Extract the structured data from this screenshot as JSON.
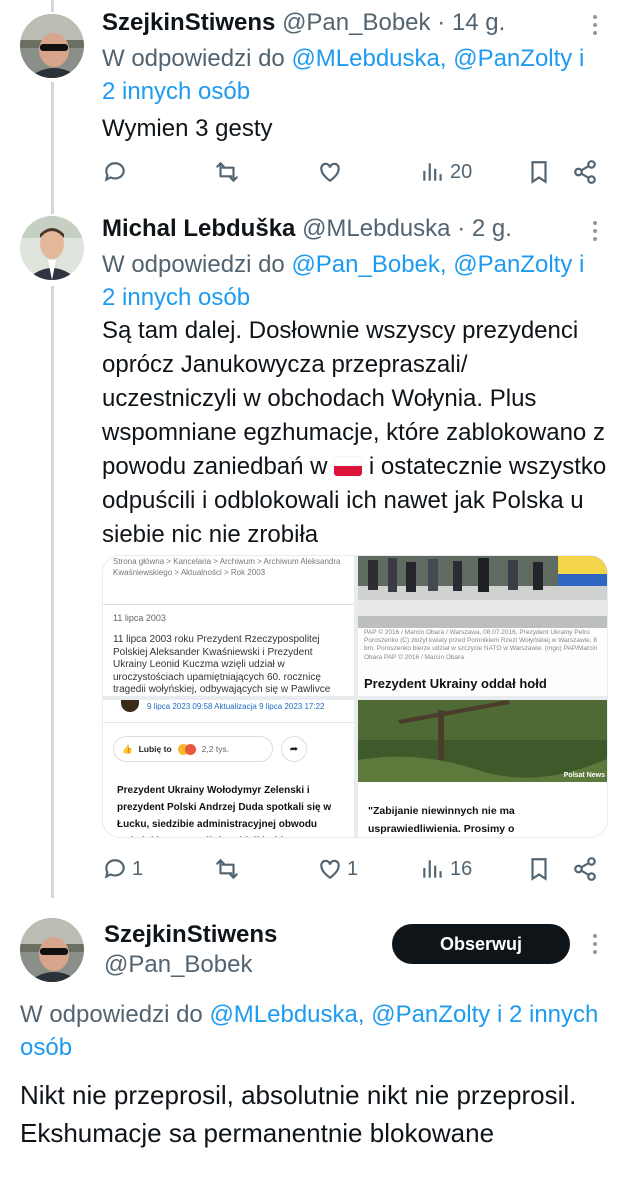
{
  "tweets": [
    {
      "name": "SzejkinStiwens",
      "handle": "@Pan_Bobek",
      "dot": "·",
      "time": "14 g.",
      "reply_prefix": "W odpowiedzi do",
      "reply_mentions": "@MLebduska, @PanZolty",
      "reply_suffix_mention": "i",
      "reply_others": "2 innych osób",
      "text": "Wymien 3 gesty",
      "actions": {
        "replies": "",
        "reposts": "",
        "likes": "",
        "views": "20"
      }
    },
    {
      "name": "Michal Lebduška",
      "handle": "@MLebduska",
      "dot": "·",
      "time": "2 g.",
      "reply_prefix": "W odpowiedzi do",
      "reply_mentions": "@Pan_Bobek, @PanZolty",
      "reply_suffix_mention": "i",
      "reply_others": "2 innych osób",
      "text_parts": [
        "Są tam dalej. Dosłownie wszyscy prezydenci oprócz Janukowycza przepraszali/ uczestniczyli w obchodach Wołynia. Plus wspomniane egzhumacje, które zablokowano z powodu zaniedbań w ",
        " i ostatecznie wszystko odpuścili i odblokowali ich nawet jak Polska u siebie nic nie zrobiła"
      ],
      "flag_emoji": "poland-flag-icon",
      "actions": {
        "replies": "1",
        "reposts": "",
        "likes": "1",
        "views": "16"
      },
      "media": {
        "img1": {
          "breadcrumb": "Strona główna > Kancelaria > Archiwum > Archiwum Aleksandra Kwaśniewskiego > Aktualności > Rok 2003",
          "date": "11 lipca 2003",
          "body": "11 lipca 2003 roku Prezydent Rzeczypospolitej Polskiej Aleksander Kwaśniewski i Prezydent Ukrainy Leonid Kuczma wzięli udział w uroczystościach upamiętniających 60. rocznicę tragedii wołyńskiej, odbywających się w Pawlivce"
        },
        "img2": {
          "caption": "PAP © 2016 / Marcin Obara / Warszawa, 08.07.2016, Prezydent Ukrainy Petro Poroszenko (C) złożył kwiaty przed Pomnikiem Rzezi Wołyńskiej w Warszawie, 8 bm. Poroszenko bierze udział w szczycie NATO w Warszawie. (mgo) PAP/Marcin Obara PAP © 2016 / Marcin Obara",
          "headline": "Prezydent Ukrainy oddał hołd"
        },
        "img3": {
          "meta": "9 lipca 2023 09:58 Aktualizacja 9 lipca 2023 17:22",
          "like_label": "Lubię to",
          "like_count": "2,2 tys.",
          "body": "Prezydent Ukrainy Wołodymyr Zelenski i prezydent Polski Andrzej Duda spotkali się w Łucku, siedzibie administracyjnej obwodu wołyńskiego. Wspólnie oddali hołd"
        },
        "img4": {
          "source": "Polsat News",
          "body": "\"Zabijanie niewinnych nie ma usprawiedliwienia. Prosimy o"
        }
      }
    },
    {
      "name": "SzejkinStiwens",
      "handle": "@Pan_Bobek",
      "follow_label": "Obserwuj",
      "reply_prefix": "W odpowiedzi do",
      "reply_mentions": "@MLebduska, @PanZolty",
      "reply_suffix_mention": "i",
      "reply_others_inline": "2 innych",
      "reply_others_wrap": "osób",
      "text": "Nikt nie przeprosil, absolutnie nikt nie przeprosil. Ekshumacje sa permanentnie blokowane"
    }
  ],
  "colors": {
    "text": "#0f1419",
    "secondary": "#536471",
    "link": "#1d9bf0",
    "thread_line": "#cfd9de",
    "button_bg": "#0f1419"
  }
}
